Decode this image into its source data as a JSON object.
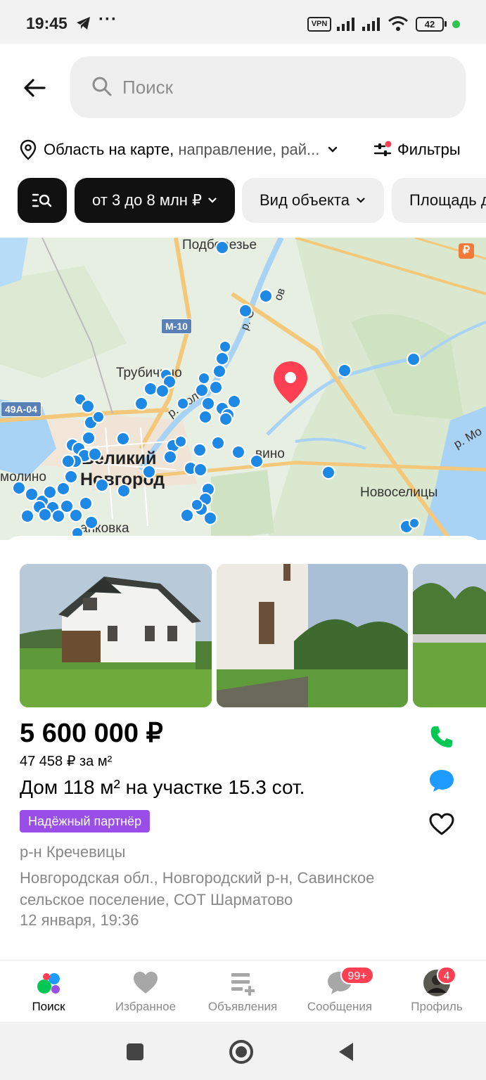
{
  "status_bar": {
    "time": "19:45",
    "battery": "42",
    "vpn": "VPN"
  },
  "header": {
    "search_placeholder": "Поиск"
  },
  "location": {
    "main": "Область на карте,",
    "sub": "направление, рай..."
  },
  "filters": {
    "label": "Фильтры",
    "has_indicator": true
  },
  "chips": [
    {
      "label": "",
      "icon": "list-search-icon"
    },
    {
      "label": "от 3 до 8 млн ₽"
    },
    {
      "label": "Вид объекта"
    },
    {
      "label": "Площадь д"
    }
  ],
  "map": {
    "labels": {
      "podberezye": "Подберезье",
      "trubichino": "Трубичино",
      "veliky": "Великий",
      "novgorod": "Новгород",
      "novoselitsy": "Новоселицы",
      "molino": "молино",
      "ankovka": "анковка",
      "vino": "вино",
      "river_volkhov": "р. Вол",
      "river_o": "р. О",
      "river_mo": "р. Мо",
      "river_ov": "ов"
    },
    "roads": {
      "m10": "М-10",
      "r49": "49А-04"
    },
    "ruble_sign": "₽"
  },
  "listing": {
    "price": "5 600 000 ₽",
    "price_per_m2": "47 458 ₽ за м²",
    "title": "Дом 118 м² на участке 15.3 сот.",
    "badge": "Надёжный партнёр",
    "district": "р-н Кречевицы",
    "address": "Новгородская обл., Новгородский р-н, Савинское сельское поселение, СОТ Шарматово",
    "date": "12 января, 19:36",
    "accent_colors": {
      "phone": "#00c853",
      "chat": "#1e9bff",
      "badge": "#9a4ee8"
    }
  },
  "bottom_nav": [
    {
      "label": "Поиск",
      "active": true
    },
    {
      "label": "Избранное"
    },
    {
      "label": "Объявления"
    },
    {
      "label": "Сообщения",
      "badge": "99+"
    },
    {
      "label": "Профиль",
      "badge": "4"
    }
  ]
}
